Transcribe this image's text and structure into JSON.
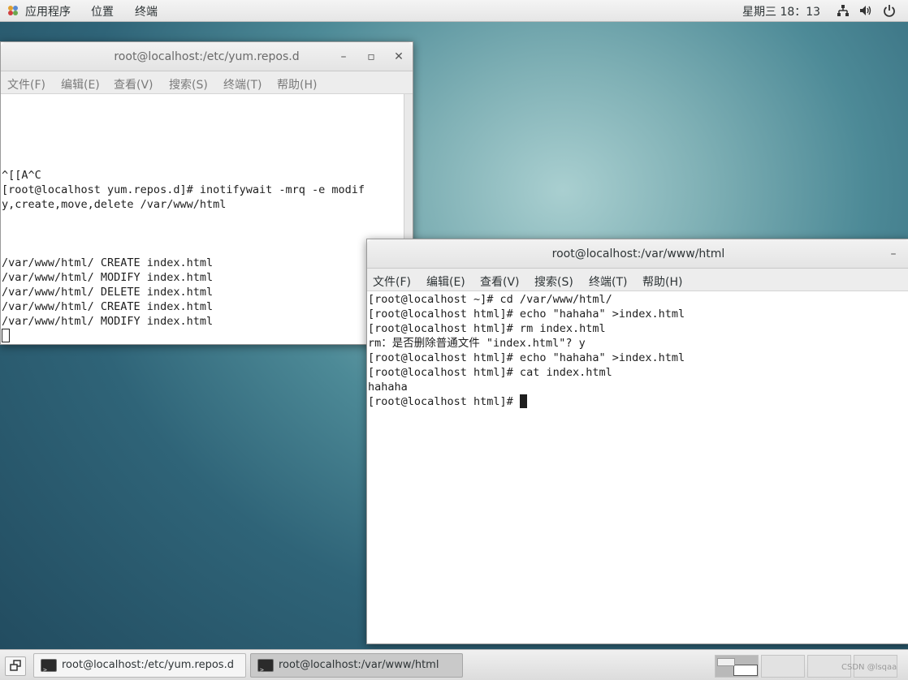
{
  "topbar": {
    "apps": "应用程序",
    "places": "位置",
    "terminal": "终端",
    "clock": "星期三 18：13",
    "icons": [
      "network-icon",
      "volume-icon",
      "power-icon"
    ]
  },
  "window1": {
    "title": "root@localhost:/etc/yum.repos.d",
    "menu": [
      "文件(F)",
      "编辑(E)",
      "查看(V)",
      "搜索(S)",
      "终端(T)",
      "帮助(H)"
    ],
    "lines": [
      "",
      "",
      "",
      "",
      "",
      "^[[A^C",
      "[root@localhost yum.repos.d]# inotifywait -mrq -e modif",
      "y,create,move,delete /var/www/html",
      "",
      "",
      "",
      "/var/www/html/ CREATE index.html",
      "/var/www/html/ MODIFY index.html",
      "/var/www/html/ DELETE index.html",
      "/var/www/html/ CREATE index.html",
      "/var/www/html/ MODIFY index.html"
    ]
  },
  "window2": {
    "title": "root@localhost:/var/www/html",
    "menu": [
      "文件(F)",
      "编辑(E)",
      "查看(V)",
      "搜索(S)",
      "终端(T)",
      "帮助(H)"
    ],
    "lines": [
      "[root@localhost ~]# cd /var/www/html/",
      "[root@localhost html]# echo \"hahaha\" >index.html",
      "[root@localhost html]# rm index.html",
      "rm：是否删除普通文件 \"index.html\"? y",
      "[root@localhost html]# echo \"hahaha\" >index.html",
      "[root@localhost html]# cat index.html",
      "hahaha",
      "[root@localhost html]# "
    ]
  },
  "taskbar": {
    "tasks": [
      "root@localhost:/etc/yum.repos.d",
      "root@localhost:/var/www/html"
    ],
    "active_task": 1,
    "workspaces": 4,
    "current_workspace": 0
  },
  "watermark": "CSDN @lsqaa",
  "colors": {
    "desktop": "#4d8a97",
    "titlebar": "#e8e8e8",
    "terminal_bg": "#ffffff",
    "terminal_fg": "#1e1e1e"
  }
}
